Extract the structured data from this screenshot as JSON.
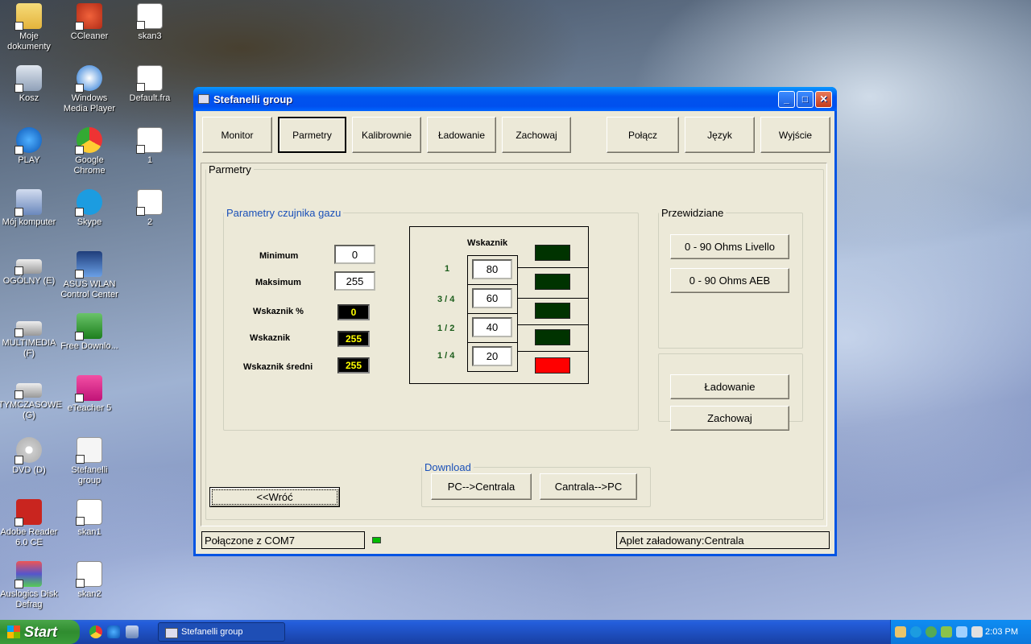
{
  "desktop": {
    "icons": [
      {
        "label": "Moje dokumenty"
      },
      {
        "label": "CCleaner"
      },
      {
        "label": "skan3"
      },
      {
        "label": "Kosz"
      },
      {
        "label": "Windows Media Player"
      },
      {
        "label": "Default.fra"
      },
      {
        "label": "PLAY"
      },
      {
        "label": "Google Chrome"
      },
      {
        "label": "1"
      },
      {
        "label": "Mój komputer"
      },
      {
        "label": "Skype"
      },
      {
        "label": "2"
      },
      {
        "label": "OGÓLNY (E)"
      },
      {
        "label": "ASUS WLAN Control Center"
      },
      {
        "label": "MULTIMEDIA (F)"
      },
      {
        "label": "Free Downlo..."
      },
      {
        "label": "TYMCZASOWE (G)"
      },
      {
        "label": "eTeacher 5"
      },
      {
        "label": "DVD (D)"
      },
      {
        "label": "Stefanelli group"
      },
      {
        "label": "Adobe Reader 6.0 CE"
      },
      {
        "label": "skan1"
      },
      {
        "label": "Auslogics Disk Defrag"
      },
      {
        "label": "skan2"
      }
    ]
  },
  "window": {
    "title": "Stefanelli group",
    "controls": {
      "minimize": "_",
      "maximize": "□",
      "close": "✕"
    }
  },
  "toolbar": {
    "monitor": "Monitor",
    "parametry": "Parmetry",
    "kalibrownie": "Kalibrownie",
    "ladowanie": "Ładowanie",
    "zachowaj": "Zachowaj",
    "polacz": "Połącz",
    "jezyk": "Język",
    "wyjscie": "Wyjście"
  },
  "panel": {
    "title": "Parmetry",
    "sensor": {
      "legend": "Parametry czujnika gazu",
      "minimum_label": "Minimum",
      "minimum_value": "0",
      "maksimum_label": "Maksimum",
      "maksimum_value": "255",
      "wskaznik_pct_label": "Wskaznik %",
      "wskaznik_pct_value": "0",
      "wskaznik_label": "Wskaznik",
      "wskaznik_value": "255",
      "wskaznik_sredni_label": "Wskaznik średni",
      "wskaznik_sredni_value": "255",
      "gauge_title": "Wskaznik",
      "levels": [
        {
          "fraction": "1",
          "value": "80"
        },
        {
          "fraction": "3 / 4",
          "value": "60"
        },
        {
          "fraction": "1 / 2",
          "value": "40"
        },
        {
          "fraction": "1 / 4",
          "value": "20"
        }
      ],
      "led_colors": [
        "#003300",
        "#003300",
        "#003300",
        "#003300",
        "#ff0000"
      ]
    },
    "predefined": {
      "legend": "Przewidziane",
      "livello": "0 - 90 Ohms Livello",
      "aeb": "0 - 90 Ohms AEB"
    },
    "actions": {
      "ladowanie": "Ładowanie",
      "zachowaj": "Zachowaj"
    },
    "download": {
      "legend": "Download",
      "pc_to_central": "PC-->Centrala",
      "central_to_pc": "Cantrala-->PC"
    },
    "back": "<<Wróć"
  },
  "statusbar": {
    "connection": "Połączone z COM7",
    "applet": "Aplet załadowany:Centrala"
  },
  "taskbar": {
    "start": "Start",
    "task": "Stefanelli group",
    "clock": "2:03 PM"
  }
}
